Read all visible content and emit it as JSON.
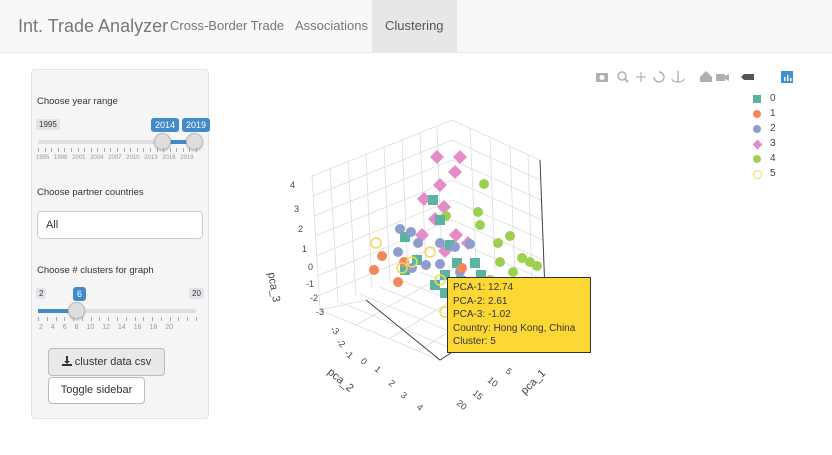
{
  "navbar": {
    "brand": "Int. Trade Analyzer",
    "tabs": [
      {
        "label": "Cross-Border Trade",
        "active": false
      },
      {
        "label": "Associations",
        "active": false
      },
      {
        "label": "Clustering",
        "active": true
      }
    ]
  },
  "sidebar": {
    "year_range": {
      "label": "Choose year range",
      "min": "1995",
      "max_label": "",
      "from": "2014",
      "to": "2019",
      "grid": [
        "1995",
        "1998",
        "2001",
        "2004",
        "2007",
        "2010",
        "2013",
        "2016",
        "2019"
      ]
    },
    "partner": {
      "label": "Choose partner countries",
      "value": "All"
    },
    "clusters": {
      "label": "Choose # clusters for graph",
      "min": "2",
      "max": "20",
      "value": "6",
      "grid": [
        "2",
        "4",
        "6",
        "8",
        "10",
        "12",
        "14",
        "16",
        "18",
        "20"
      ]
    },
    "download_label": "cluster data csv",
    "toggle_label": "Toggle sidebar"
  },
  "plot": {
    "axes": {
      "x": "pca_1",
      "y": "pca_2",
      "z": "pca_3"
    },
    "x_ticks": [
      "5",
      "10",
      "15",
      "20"
    ],
    "y_ticks": [
      "-3",
      "-2",
      "-1",
      "0",
      "1",
      "2",
      "3",
      "4"
    ],
    "z_ticks": [
      "4",
      "3",
      "2",
      "1",
      "0",
      "-1",
      "-2",
      "-3"
    ],
    "legend": [
      {
        "label": "0",
        "color": "#5ab4a1",
        "shape": "square"
      },
      {
        "label": "1",
        "color": "#f4875a",
        "shape": "circle"
      },
      {
        "label": "2",
        "color": "#8d9dce",
        "shape": "circle"
      },
      {
        "label": "3",
        "color": "#e58bc8",
        "shape": "diamond"
      },
      {
        "label": "4",
        "color": "#9ed04f",
        "shape": "circle"
      },
      {
        "label": "5",
        "color": "#f1d95a",
        "shape": "open-circle"
      }
    ],
    "tooltip": {
      "line1": "PCA-1: 12.74",
      "line2": "PCA-2: 2.61",
      "line3": "PCA-3: -1.02",
      "line4": "Country: Hong Kong, China",
      "line5": "Cluster: 5"
    }
  }
}
